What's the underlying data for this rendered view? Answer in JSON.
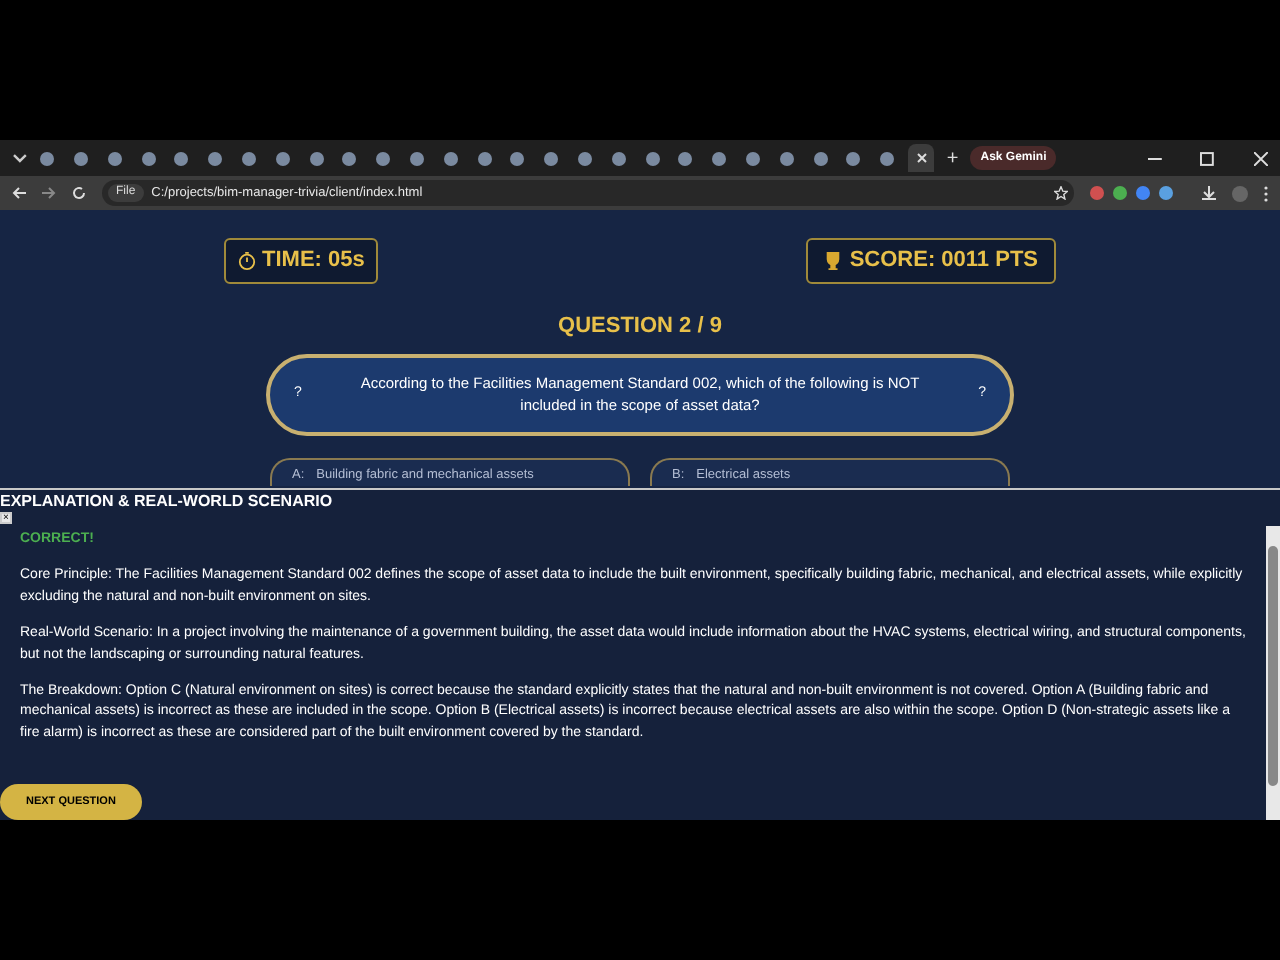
{
  "browser": {
    "tabs": [
      {
        "selected": false
      },
      {
        "selected": false
      },
      {
        "selected": false
      },
      {
        "selected": false
      },
      {
        "selected": false
      },
      {
        "selected": false
      },
      {
        "selected": false
      },
      {
        "selected": false
      },
      {
        "selected": false
      },
      {
        "selected": false
      },
      {
        "selected": false
      },
      {
        "selected": false
      },
      {
        "selected": false
      },
      {
        "selected": false
      },
      {
        "selected": false
      },
      {
        "selected": false
      },
      {
        "selected": false
      },
      {
        "selected": false
      },
      {
        "selected": false
      },
      {
        "selected": false
      },
      {
        "selected": false
      },
      {
        "selected": false
      },
      {
        "selected": false
      },
      {
        "selected": false
      },
      {
        "selected": false
      },
      {
        "selected": false
      },
      {
        "selected": true
      }
    ],
    "new_tab": "+",
    "ask_button": "Ask Gemini",
    "file_chip": "File",
    "url": "C:/projects/bim-manager-trivia/client/index.html"
  },
  "timer": "TIME: 05s",
  "score": "SCORE: 0011 PTS",
  "question_counter": "QUESTION 2 / 9",
  "question": {
    "left_mark": "?",
    "text": "According to the Facilities Management Standard 002, which of the following is NOT included in the scope of asset data?",
    "right_mark": "?"
  },
  "options": [
    {
      "letter": "A:",
      "text": "Building fabric and mechanical assets"
    },
    {
      "letter": "B:",
      "text": "Electrical assets"
    }
  ],
  "explanation": {
    "title": "EXPLANATION & REAL-WORLD SCENARIO",
    "close": "×",
    "result": "CORRECT!",
    "paragraphs": [
      "Core Principle: The Facilities Management Standard 002 defines the scope of asset data to include the built environment, specifically building fabric, mechanical, and electrical assets, while explicitly excluding the natural and non-built environment on sites.",
      "Real-World Scenario: In a project involving the maintenance of a government building, the asset data would include information about the HVAC systems, electrical wiring, and structural components, but not the landscaping or surrounding natural features.",
      "The Breakdown: Option C (Natural environment on sites) is correct because the standard explicitly states that the natural and non-built environment is not covered. Option A (Building fabric and mechanical assets) is incorrect as these are included in the scope. Option B (Electrical assets) is incorrect because electrical assets are also within the scope. Option D (Non-strategic assets like a fire alarm) is incorrect as these are considered part of the built environment covered by the standard."
    ],
    "next_button": "NEXT QUESTION"
  }
}
